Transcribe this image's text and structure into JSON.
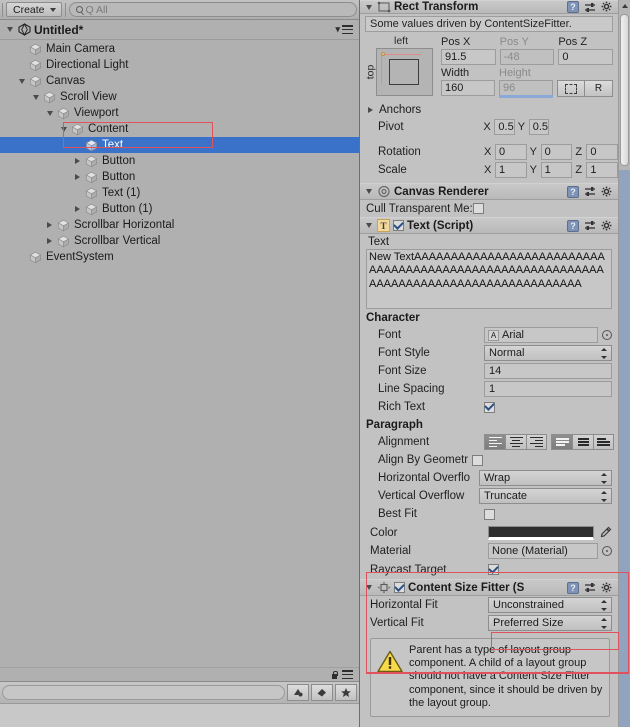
{
  "hierarchy": {
    "toolbar": {
      "create_label": "Create",
      "search_placeholder": "Q All",
      "search_value": ""
    },
    "scene_name": "Untitled*",
    "nodes": [
      {
        "label": "Main Camera",
        "depth": 1,
        "arrow": "none",
        "selected": false
      },
      {
        "label": "Directional Light",
        "depth": 1,
        "arrow": "none",
        "selected": false
      },
      {
        "label": "Canvas",
        "depth": 1,
        "arrow": "down",
        "selected": false
      },
      {
        "label": "Scroll View",
        "depth": 2,
        "arrow": "down",
        "selected": false
      },
      {
        "label": "Viewport",
        "depth": 3,
        "arrow": "down",
        "selected": false
      },
      {
        "label": "Content",
        "depth": 4,
        "arrow": "down",
        "selected": false
      },
      {
        "label": "Text",
        "depth": 5,
        "arrow": "none",
        "selected": true
      },
      {
        "label": "Button",
        "depth": 5,
        "arrow": "right",
        "selected": false
      },
      {
        "label": "Button",
        "depth": 5,
        "arrow": "right",
        "selected": false
      },
      {
        "label": "Text (1)",
        "depth": 5,
        "arrow": "none",
        "selected": false
      },
      {
        "label": "Button (1)",
        "depth": 5,
        "arrow": "right",
        "selected": false
      },
      {
        "label": "Scrollbar Horizontal",
        "depth": 3,
        "arrow": "right",
        "selected": false
      },
      {
        "label": "Scrollbar Vertical",
        "depth": 3,
        "arrow": "right",
        "selected": false
      },
      {
        "label": "EventSystem",
        "depth": 1,
        "arrow": "none",
        "selected": false
      }
    ],
    "bottom": {
      "lock_icon": "lock-icon",
      "menu_icon": "hamburger-icon",
      "project_search_value": "",
      "buttons": [
        "paint-icon",
        "label-icon",
        "star-icon"
      ]
    }
  },
  "inspector": {
    "rect_transform": {
      "title": "Rect Transform",
      "driven_notice": "Some values driven by ContentSizeFitter.",
      "anchor_preset": {
        "top_label": "left",
        "left_label": "top"
      },
      "pos_x_label": "Pos X",
      "pos_x_value": "91.5",
      "pos_y_label": "Pos Y",
      "pos_y_value": "-48",
      "pos_z_label": "Pos Z",
      "pos_z_value": "0",
      "width_label": "Width",
      "width_value": "160",
      "height_label": "Height",
      "height_value": "96",
      "blueprint_button": "blueprint-mode-icon",
      "raw_button": "R",
      "anchors_label": "Anchors",
      "pivot_label": "Pivot",
      "pivot_x": "0.5",
      "pivot_y": "0.5",
      "rotation_label": "Rotation",
      "rot_x": "0",
      "rot_y": "0",
      "rot_z": "0",
      "scale_label": "Scale",
      "scale_x": "1",
      "scale_y": "1",
      "scale_z": "1"
    },
    "canvas_renderer": {
      "title": "Canvas Renderer",
      "cull_label": "Cull Transparent Me:",
      "cull_checked": false
    },
    "text_script": {
      "title": "Text (Script)",
      "enabled": true,
      "text_label": "Text",
      "text_value": "New TextAAAAAAAAAAAAAAAAAAAAAAAAAAAAAAAAAAAAAAAAAAAAAAAAAAAAAAAAAAAAAAAAAAAAAAAAAAAAAAAAAAAAAAA",
      "character_header": "Character",
      "font_label": "Font",
      "font_value": "Arial",
      "font_style_label": "Font Style",
      "font_style_value": "Normal",
      "font_size_label": "Font Size",
      "font_size_value": "14",
      "line_spacing_label": "Line Spacing",
      "line_spacing_value": "1",
      "rich_text_label": "Rich Text",
      "rich_text_checked": true,
      "paragraph_header": "Paragraph",
      "alignment_label": "Alignment",
      "alignment_horizontal": [
        "align-left-icon",
        "align-center-icon",
        "align-right-icon"
      ],
      "alignment_horizontal_active": 0,
      "alignment_vertical": [
        "align-top-icon",
        "align-middle-icon",
        "align-bottom-icon"
      ],
      "alignment_vertical_active": 0,
      "align_by_geometry_label": "Align By Geometr",
      "align_by_geometry_checked": false,
      "horizontal_overflow_label": "Horizontal Overflo",
      "horizontal_overflow_value": "Wrap",
      "vertical_overflow_label": "Vertical Overflow",
      "vertical_overflow_value": "Truncate",
      "best_fit_label": "Best Fit",
      "best_fit_checked": false,
      "color_label": "Color",
      "color_value": "#2E2E2E",
      "material_label": "Material",
      "material_value": "None (Material)",
      "raycast_target_label": "Raycast Target",
      "raycast_target_checked": true
    },
    "content_size_fitter": {
      "title": "Content Size Fitter (S",
      "enabled": true,
      "horizontal_fit_label": "Horizontal Fit",
      "horizontal_fit_value": "Unconstrained",
      "vertical_fit_label": "Vertical Fit",
      "vertical_fit_value": "Preferred Size",
      "warning": "Parent has a type of layout group component. A child of a layout group should not have a Content Size Fitter component, since it should be driven by the layout group."
    }
  },
  "theme": {
    "selection_blue": "#3a72c9",
    "annotation_red": "#e0515c",
    "panel_bg": "#c2c2c2",
    "hierarchy_bg": "#b0b0b0"
  }
}
